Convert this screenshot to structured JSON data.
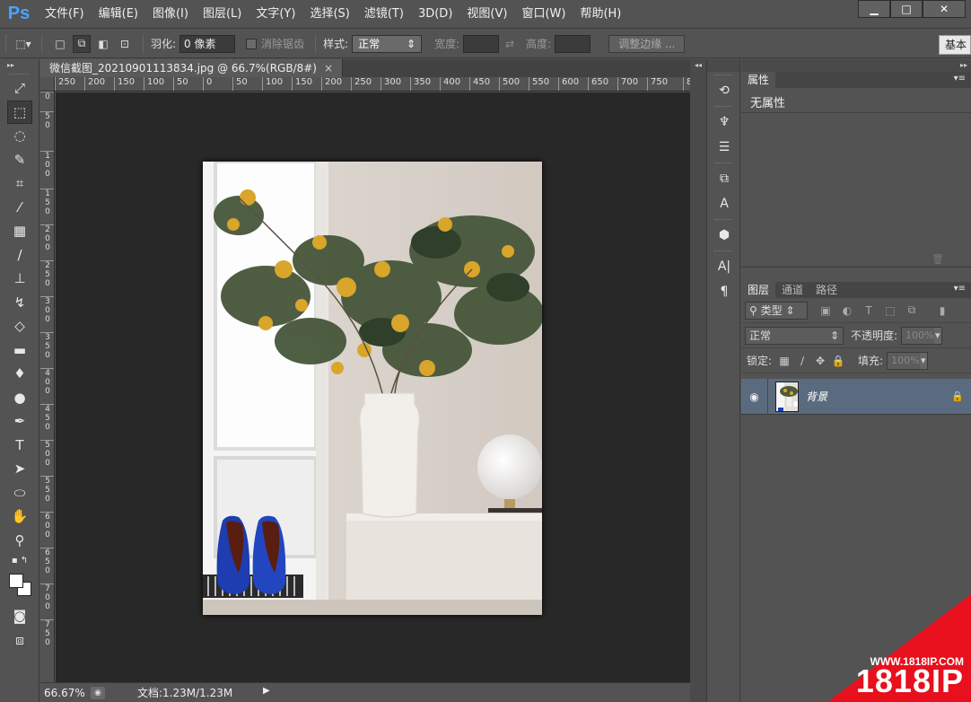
{
  "app": {
    "logo": "Ps",
    "menus": [
      "文件(F)",
      "编辑(E)",
      "图像(I)",
      "图层(L)",
      "文字(Y)",
      "选择(S)",
      "滤镜(T)",
      "3D(D)",
      "视图(V)",
      "窗口(W)",
      "帮助(H)"
    ],
    "window_controls": {
      "minimize": "▁",
      "maximize": "□",
      "close": "✕"
    }
  },
  "options": {
    "feather_label": "羽化:",
    "feather_value": "0 像素",
    "antialias_label": "消除锯齿",
    "style_label": "样式:",
    "style_value": "正常",
    "width_label": "宽度:",
    "height_label": "高度:",
    "refine_edge": "调整边缘 ...",
    "workspace": "基本"
  },
  "document": {
    "tab_title": "微信截图_20210901113834.jpg @ 66.7%(RGB/8#)",
    "tab_close": "×",
    "ruler_h": [
      "250",
      "200",
      "150",
      "100",
      "50",
      "0",
      "50",
      "100",
      "150",
      "200",
      "250",
      "300",
      "350",
      "400",
      "450",
      "500",
      "550",
      "600",
      "650",
      "700",
      "750",
      "8"
    ],
    "ruler_v": [
      "0",
      "5\n0",
      "1\n0\n0",
      "1\n5\n0",
      "2\n0\n0",
      "2\n5\n0",
      "3\n0\n0",
      "3\n5\n0",
      "4\n0\n0",
      "4\n5\n0",
      "5\n0\n0",
      "5\n5\n0",
      "6\n0\n0",
      "6\n5\n0",
      "7\n0\n0",
      "7\n5\n0"
    ]
  },
  "status": {
    "zoom": "66.67%",
    "doc_info": "文档:1.23M/1.23M"
  },
  "properties": {
    "tab": "属性",
    "empty_text": "无属性"
  },
  "layers": {
    "tabs": [
      "图层",
      "通道",
      "路径"
    ],
    "filter_kind": "类型",
    "blend_mode": "正常",
    "opacity_label": "不透明度:",
    "opacity_value": "100%",
    "lock_label": "锁定:",
    "fill_label": "填充:",
    "fill_value": "100%",
    "items": [
      {
        "name": "背景"
      }
    ]
  },
  "watermark": {
    "url": "WWW.1818IP.COM",
    "brand": "1818IP"
  }
}
